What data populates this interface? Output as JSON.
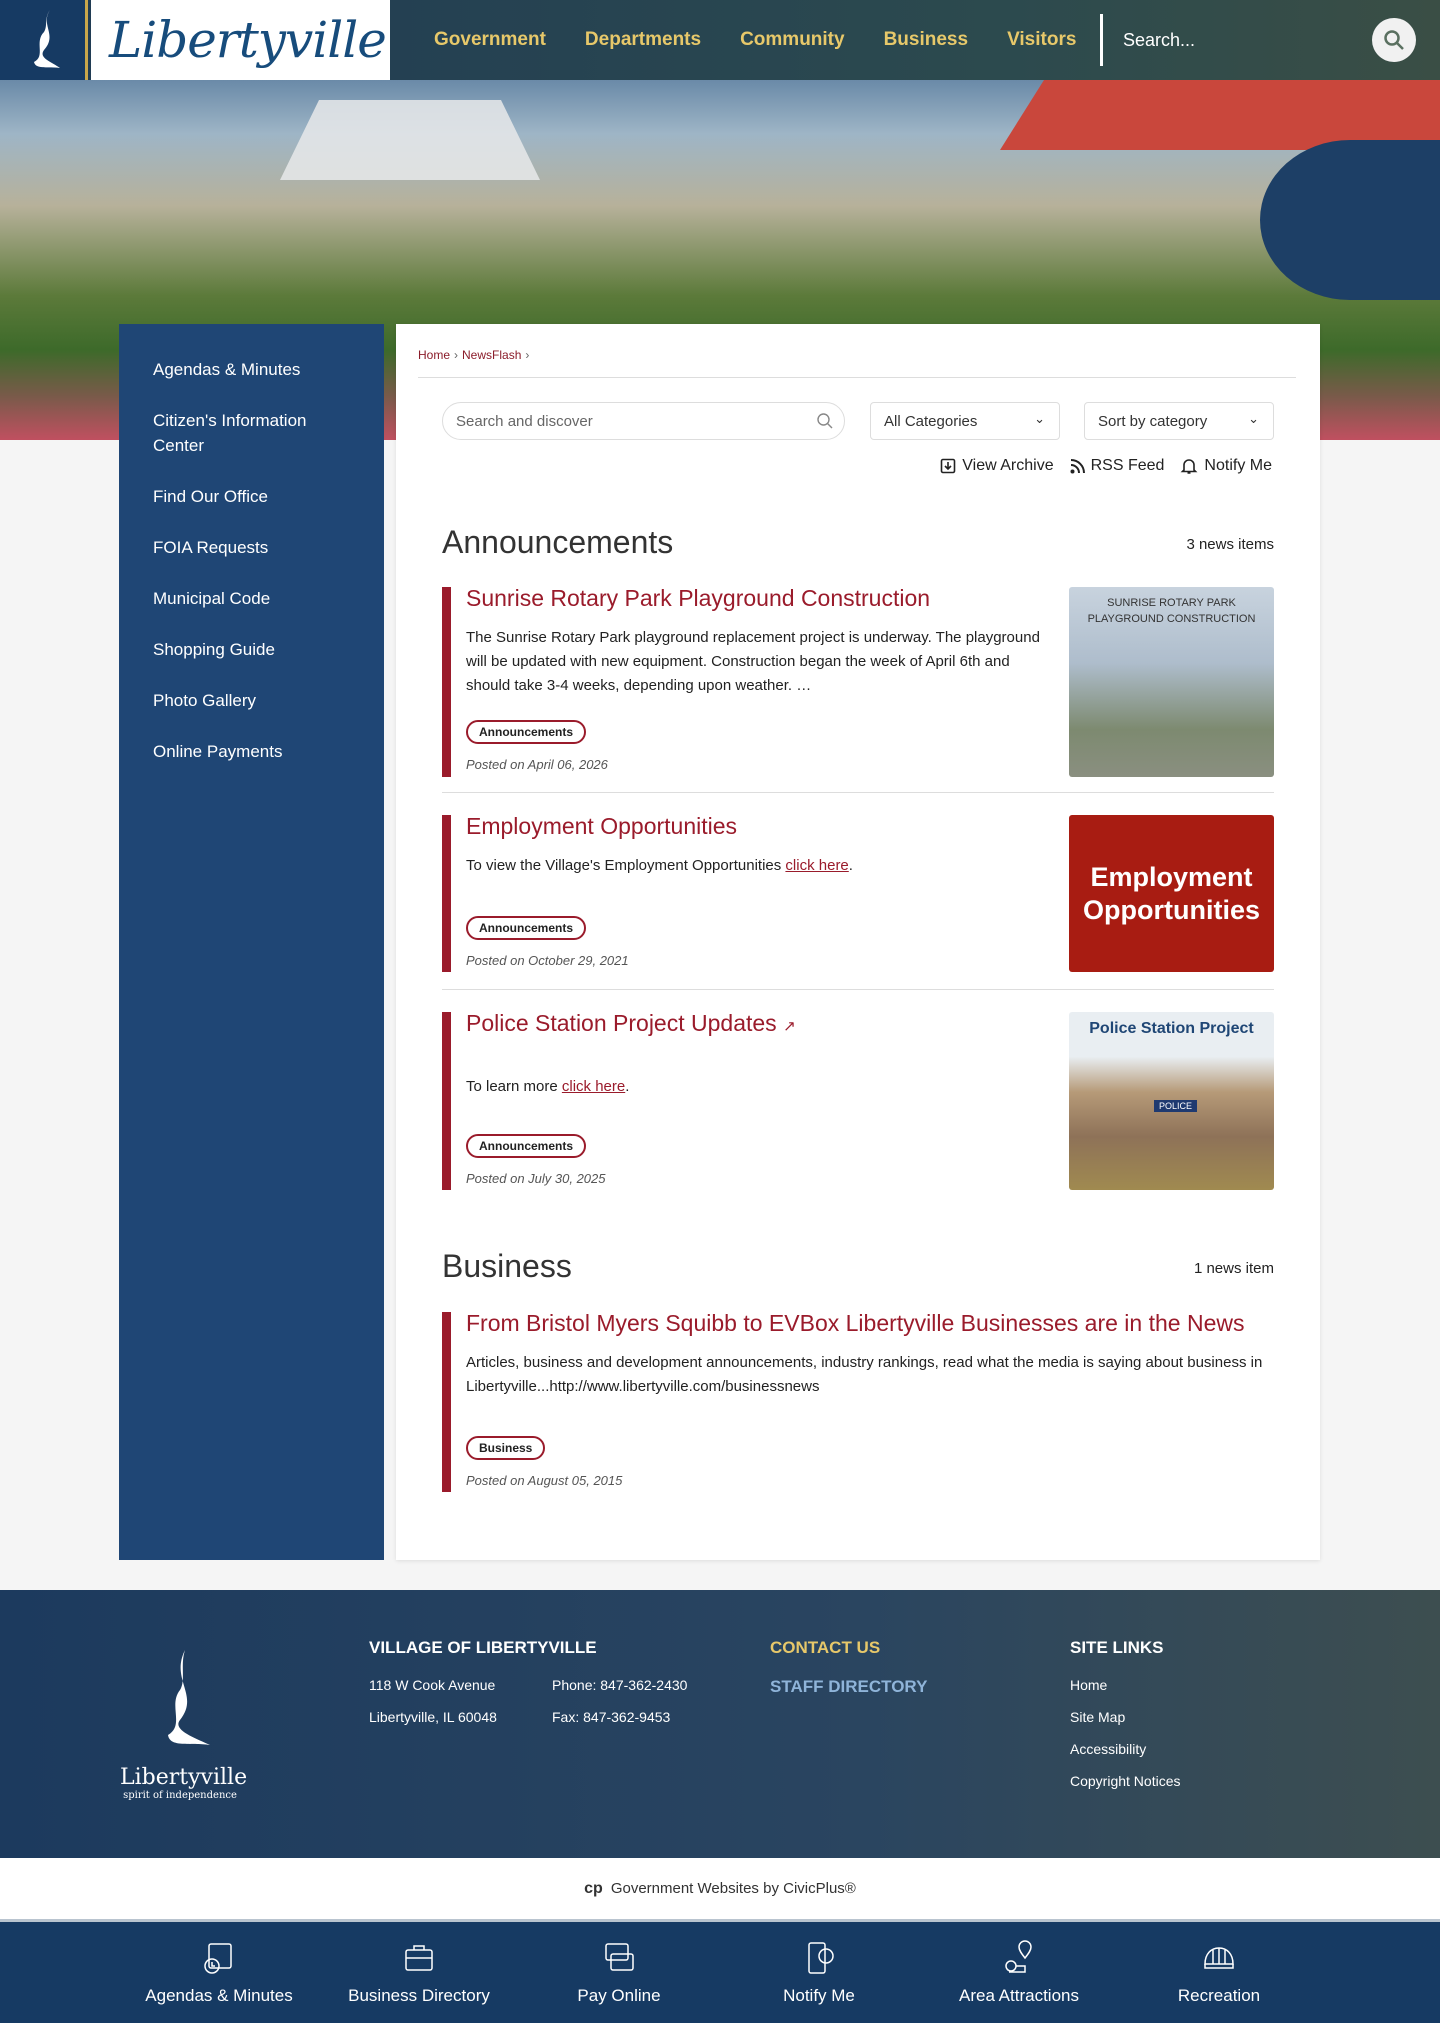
{
  "header": {
    "logo": "Libertyville",
    "nav": [
      "Government",
      "Departments",
      "Community",
      "Business",
      "Visitors"
    ],
    "search_placeholder": "Search..."
  },
  "sidebar": {
    "items": [
      "Agendas & Minutes",
      "Citizen's Information Center",
      "Find Our Office",
      "FOIA Requests",
      "Municipal Code",
      "Shopping Guide",
      "Photo Gallery",
      "Online Payments"
    ]
  },
  "breadcrumb": [
    "Home",
    "NewsFlash"
  ],
  "filters": {
    "search_placeholder": "Search and discover",
    "category": "All Categories",
    "sort": "Sort by category"
  },
  "tools": {
    "archive": "View Archive",
    "rss": "RSS Feed",
    "notify": "Notify Me"
  },
  "sections": [
    {
      "title": "Announcements",
      "count": "3 news items",
      "items": [
        {
          "title": "Sunrise Rotary Park Playground Construction",
          "body": "The Sunrise Rotary Park playground replacement project is underway. The playground will be updated with new equipment. Construction began the week of April 6th and should take 3-4 weeks, depending upon weather. …",
          "tag": "Announcements",
          "posted": "Posted on April 06, 2026",
          "thumb": "SUNRISE ROTARY PARK PLAYGROUND CONSTRUCTION"
        },
        {
          "title": "Employment Opportunities",
          "body_pre": "To view the Village's Employment Opportunities ",
          "link": "click here",
          "body_post": ".",
          "tag": "Announcements",
          "posted": "Posted on October 29, 2021",
          "thumb": "Employment Opportunities"
        },
        {
          "title": "Police Station Project Updates",
          "body_pre": "To learn more ",
          "link": "click here",
          "body_post": ".",
          "tag": "Announcements",
          "posted": "Posted on July 30, 2025",
          "thumb": "Police Station Project",
          "sign": "POLICE"
        }
      ]
    },
    {
      "title": "Business",
      "count": "1 news item",
      "items": [
        {
          "title": "From Bristol Myers Squibb to EVBox Libertyville Businesses are in the News",
          "body": "Articles, business and development announcements, industry rankings, read what the media is saying about business in Libertyville...http://www.libertyville.com/businessnews",
          "tag": "Business",
          "posted": "Posted on August 05, 2015"
        }
      ]
    }
  ],
  "footer": {
    "logo": "Libertyville",
    "tagline": "spirit of independence",
    "village_title": "VILLAGE OF LIBERTYVILLE",
    "address1": "118 W Cook Avenue",
    "address2": "Libertyville, IL 60048",
    "phone": "Phone: 847-362-2430",
    "fax": "Fax: 847-362-9453",
    "contact": "CONTACT US",
    "staff": "STAFF DIRECTORY",
    "links_title": "SITE LINKS",
    "links": [
      "Home",
      "Site Map",
      "Accessibility",
      "Copyright Notices"
    ]
  },
  "civicplus": "Government Websites by CivicPlus®",
  "bottom": [
    "Agendas & Minutes",
    "Business Directory",
    "Pay Online",
    "Notify Me",
    "Area Attractions",
    "Recreation"
  ],
  "colors": {
    "accent": "#9a1b2b",
    "nav": "#e7c86a",
    "sidebar": "#1f4675"
  }
}
